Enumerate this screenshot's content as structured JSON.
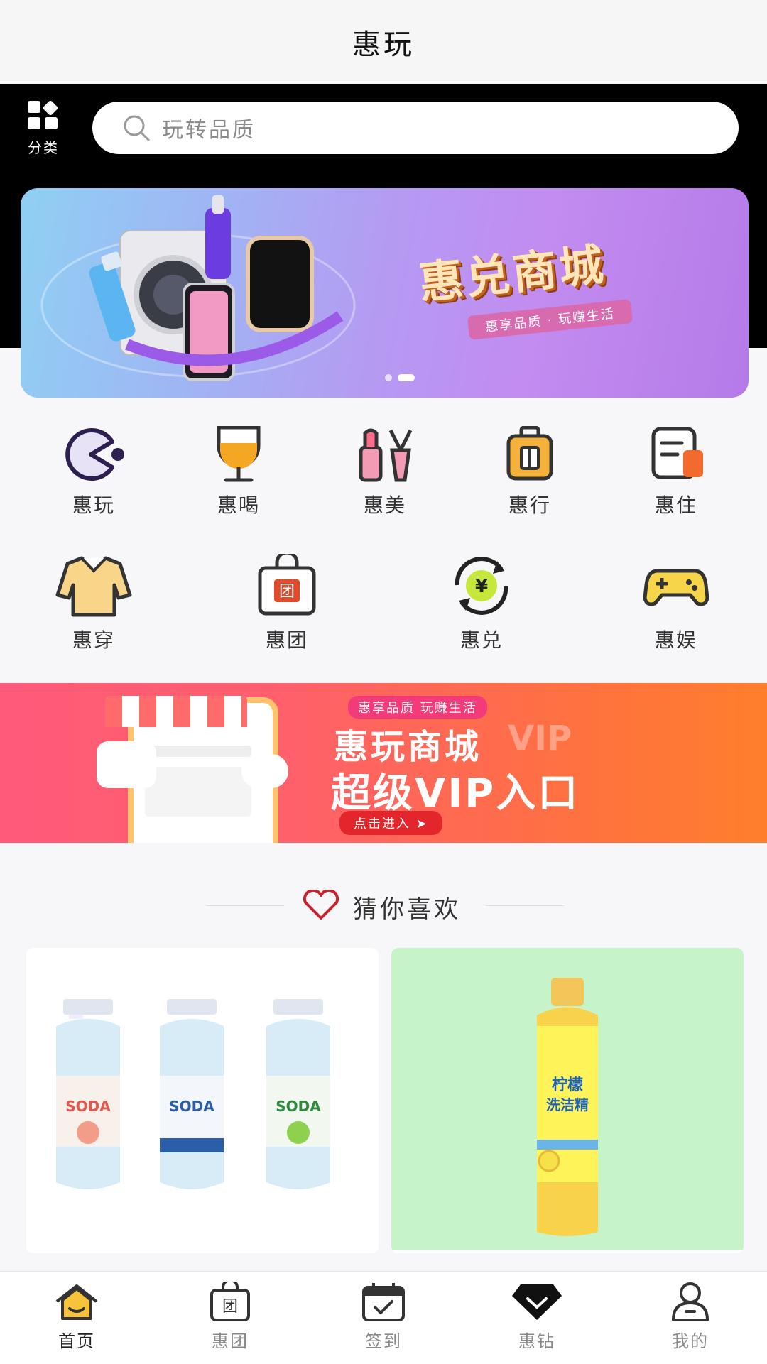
{
  "header": {
    "title": "惠玩"
  },
  "topbar": {
    "category_label": "分类",
    "search_placeholder": "玩转品质"
  },
  "banner_main": {
    "brand_text": "惠兑商城",
    "tagline": "惠享品质 · 玩赚生活",
    "dots": 2,
    "active_dot": 1
  },
  "categories_row1": [
    {
      "label": "惠玩",
      "icon": "pacman-icon"
    },
    {
      "label": "惠喝",
      "icon": "wine-glass-icon"
    },
    {
      "label": "惠美",
      "icon": "cosmetics-icon"
    },
    {
      "label": "惠行",
      "icon": "luggage-icon"
    },
    {
      "label": "惠住",
      "icon": "hotel-doc-icon"
    }
  ],
  "categories_row2": [
    {
      "label": "惠穿",
      "icon": "shirt-icon"
    },
    {
      "label": "惠团",
      "icon": "group-bag-icon"
    },
    {
      "label": "惠兑",
      "icon": "exchange-yen-icon"
    },
    {
      "label": "惠娱",
      "icon": "gamepad-icon"
    }
  ],
  "banner_vip": {
    "slogan": "惠享品质 玩赚生活",
    "title": "惠玩商城",
    "vip_watermark": "VIP",
    "subtitle": "超级VIP入口",
    "cta": "点击进入 ➤"
  },
  "recommend": {
    "title": "猜你喜欢"
  },
  "tabbar": {
    "items": [
      {
        "label": "首页",
        "icon": "home-icon",
        "active": true
      },
      {
        "label": "惠团",
        "icon": "group-bag-icon",
        "active": false
      },
      {
        "label": "签到",
        "icon": "calendar-check-icon",
        "active": false
      },
      {
        "label": "惠钻",
        "icon": "diamond-icon",
        "active": false
      },
      {
        "label": "我的",
        "icon": "user-icon",
        "active": false
      }
    ]
  },
  "colors": {
    "accent_black": "#000000",
    "vip_gradient_start": "#ff5a7a",
    "vip_gradient_end": "#ff7e2c",
    "heart": "#c8232c",
    "home_icon": "#f6c33b"
  }
}
